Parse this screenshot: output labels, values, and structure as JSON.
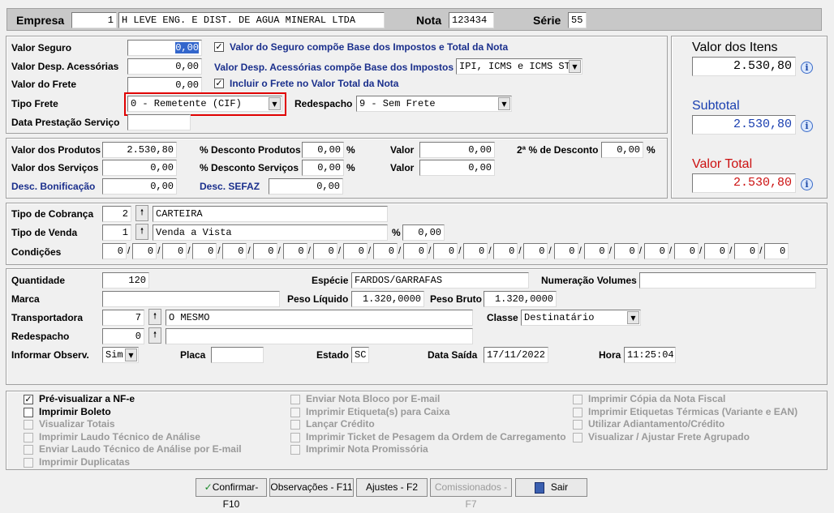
{
  "header": {
    "empresa_label": "Empresa",
    "empresa_code": "1",
    "empresa_name": "H LEVE ENG. E DIST. DE AGUA MINERAL LTDA",
    "nota_label": "Nota",
    "nota_value": "123434",
    "serie_label": "Série",
    "serie_value": "55"
  },
  "valores": {
    "seguro_label": "Valor Seguro",
    "seguro_value": "0,00",
    "seguro_check_label": "Valor do Seguro compõe Base dos Impostos e Total da Nota",
    "desp_label": "Valor Desp. Acessórias",
    "desp_value": "0,00",
    "desp_base_label": "Valor Desp. Acessórias compõe Base dos Impostos",
    "desp_base_value": "IPI, ICMS e ICMS ST",
    "frete_label": "Valor do Frete",
    "frete_value": "0,00",
    "frete_check_label": "Incluir o Frete no Valor Total da Nota",
    "tipo_frete_label": "Tipo Frete",
    "tipo_frete_value": "0 - Remetente (CIF)",
    "redespacho_label": "Redespacho",
    "redespacho_value": "9 - Sem Frete",
    "data_prest_label": "Data Prestação Serviço",
    "data_prest_value": ""
  },
  "totais": {
    "itens_label": "Valor dos Itens",
    "itens_value": "2.530,80",
    "subtotal_label": "Subtotal",
    "subtotal_value": "2.530,80",
    "total_label": "Valor Total",
    "total_value": "2.530,80"
  },
  "produtos": {
    "produtos_label": "Valor dos Produtos",
    "produtos_value": "2.530,80",
    "servicos_label": "Valor dos Serviços",
    "servicos_value": "0,00",
    "bonif_label": "Desc. Bonificação",
    "bonif_value": "0,00",
    "desc_prod_label": "% Desconto Produtos",
    "desc_prod_value": "0,00",
    "desc_serv_label": "% Desconto Serviços",
    "desc_serv_value": "0,00",
    "sefaz_label": "Desc. SEFAZ",
    "sefaz_value": "0,00",
    "valor_label": "Valor",
    "valor1_value": "0,00",
    "valor2_value": "0,00",
    "desc2_label": "2ª % de Desconto",
    "desc2_value": "0,00",
    "percent": "%"
  },
  "cobranca": {
    "tipo_cobranca_label": "Tipo de Cobrança",
    "tipo_cobranca_code": "2",
    "tipo_cobranca_name": "CARTEIRA",
    "tipo_venda_label": "Tipo de Venda",
    "tipo_venda_code": "1",
    "tipo_venda_name": "Venda a Vista",
    "venda_pct": "0,00",
    "condicoes_label": "Condições",
    "condicoes": [
      "0",
      "0",
      "0",
      "0",
      "0",
      "0",
      "0",
      "0",
      "0",
      "0",
      "0",
      "0",
      "0",
      "0",
      "0",
      "0",
      "0",
      "0",
      "0",
      "0",
      "0",
      "0",
      "0"
    ]
  },
  "transporte": {
    "quantidade_label": "Quantidade",
    "quantidade_value": "120",
    "especie_label": "Espécie",
    "especie_value": "FARDOS/GARRAFAS",
    "numeracao_label": "Numeração Volumes",
    "numeracao_value": "",
    "marca_label": "Marca",
    "marca_value": "",
    "peso_liq_label": "Peso Líquido",
    "peso_liq_value": "1.320,0000",
    "peso_bruto_label": "Peso Bruto",
    "peso_bruto_value": "1.320,0000",
    "transp_label": "Transportadora",
    "transp_code": "7",
    "transp_name": "O MESMO",
    "classe_label": "Classe",
    "classe_value": "Destinatário",
    "redesp_label": "Redespacho",
    "redesp_code": "0",
    "redesp_name": "",
    "obs_label": "Informar Observ.",
    "obs_value": "Sim",
    "placa_label": "Placa",
    "placa_value": "",
    "estado_label": "Estado",
    "estado_value": "SC",
    "data_saida_label": "Data Saída",
    "data_saida_value": "17/11/2022",
    "hora_label": "Hora",
    "hora_value": "11:25:04"
  },
  "options": {
    "col1": [
      {
        "label": "Pré-visualizar a NF-e",
        "checked": true,
        "enabled": true
      },
      {
        "label": "Imprimir Boleto",
        "checked": false,
        "enabled": true
      },
      {
        "label": "Visualizar Totais",
        "checked": false,
        "enabled": false
      },
      {
        "label": "Imprimir Laudo Técnico de Análise",
        "checked": false,
        "enabled": false
      },
      {
        "label": "Enviar Laudo Técnico de Análise por E-mail",
        "checked": false,
        "enabled": false
      },
      {
        "label": "Imprimir Duplicatas",
        "checked": false,
        "enabled": false
      }
    ],
    "col2": [
      {
        "label": "Enviar Nota Bloco por E-mail",
        "checked": false,
        "enabled": false
      },
      {
        "label": "Imprimir Etiqueta(s) para Caixa",
        "checked": false,
        "enabled": false
      },
      {
        "label": "Lançar Crédito",
        "checked": false,
        "enabled": false
      },
      {
        "label": "Imprimir Ticket de Pesagem da Ordem de Carregamento",
        "checked": false,
        "enabled": false
      },
      {
        "label": "Imprimir Nota Promissória",
        "checked": false,
        "enabled": false
      }
    ],
    "col3": [
      {
        "label": "Imprimir Cópia da Nota Fiscal",
        "checked": false,
        "enabled": false
      },
      {
        "label": "Imprimir Etiquetas Térmicas (Variante e EAN)",
        "checked": false,
        "enabled": false
      },
      {
        "label": "Utilizar Adiantamento/Crédito",
        "checked": false,
        "enabled": false
      },
      {
        "label": "Visualizar / Ajustar Frete Agrupado",
        "checked": false,
        "enabled": false
      }
    ]
  },
  "buttons": {
    "confirmar": "Confirmar-F10",
    "observacoes": "Observações - F11",
    "ajustes": "Ajustes - F2",
    "comissionados": "Comissionados - F7",
    "sair": "Sair"
  },
  "icons": {
    "check": "✓",
    "arrow_down": "▼",
    "arrow_up": "🠕",
    "info": "i"
  },
  "colors": {
    "label_blue": "#1a2f8c",
    "total_red": "#cc1111",
    "subtotal_blue": "#1a3fb0",
    "highlight_red": "#e00000"
  }
}
